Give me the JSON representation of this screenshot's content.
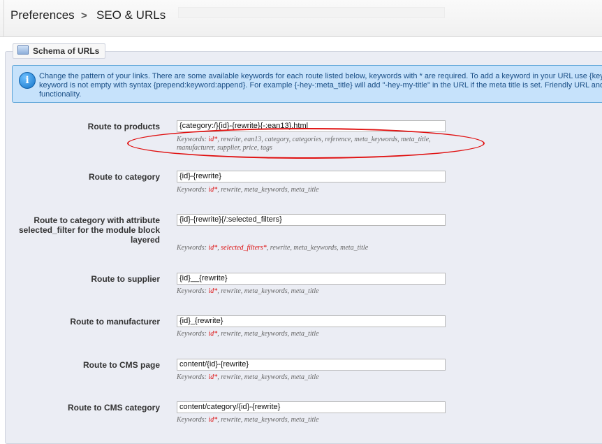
{
  "breadcrumb": {
    "parent": "Preferences",
    "separator": ">",
    "current": "SEO & URLs"
  },
  "section": {
    "legend": "Schema of URLs"
  },
  "info": {
    "text": "Change the pattern of your links. There are some available keywords for each route listed below, keywords with * are required. To add a keyword in your URL use {key keyword is not empty with syntax {prepend:keyword:append}. For example {-hey-:meta_title} will add \"-hey-my-title\" in the URL if the meta title is set. Friendly URL and functionality."
  },
  "routes": [
    {
      "label": "Route to products",
      "value": "{category:/}{id}-{rewrite}{-:ean13}.html",
      "keywords_prefix": "Keywords: ",
      "required": "id*",
      "required2": "",
      "rest": ", rewrite, ean13, category, categories, reference, meta_keywords, meta_title, manufacturer, supplier, price, tags"
    },
    {
      "label": "Route to category",
      "value": "{id}-{rewrite}",
      "keywords_prefix": "Keywords: ",
      "required": "id*",
      "required2": "",
      "rest": ", rewrite, meta_keywords, meta_title"
    },
    {
      "label": "Route to category with attribute selected_filter for the module block layered",
      "value": "{id}-{rewrite}{/:selected_filters}",
      "keywords_prefix": "Keywords: ",
      "required": "id*",
      "required2": "selected_filters*",
      "rest": ", rewrite, meta_keywords, meta_title"
    },
    {
      "label": "Route to supplier",
      "value": "{id}__{rewrite}",
      "keywords_prefix": "Keywords: ",
      "required": "id*",
      "required2": "",
      "rest": ", rewrite, meta_keywords, meta_title"
    },
    {
      "label": "Route to manufacturer",
      "value": "{id}_{rewrite}",
      "keywords_prefix": "Keywords: ",
      "required": "id*",
      "required2": "",
      "rest": ", rewrite, meta_keywords, meta_title"
    },
    {
      "label": "Route to CMS page",
      "value": "content/{id}-{rewrite}",
      "keywords_prefix": "Keywords: ",
      "required": "id*",
      "required2": "",
      "rest": ", rewrite, meta_keywords, meta_title"
    },
    {
      "label": "Route to CMS category",
      "value": "content/category/{id}-{rewrite}",
      "keywords_prefix": "Keywords: ",
      "required": "id*",
      "required2": "",
      "rest": ", rewrite, meta_keywords, meta_title"
    }
  ],
  "colors": {
    "required": "#d11111",
    "annotation": "#e01010",
    "info_bg": "#c6e2fb"
  },
  "icons": {
    "info": "info-icon",
    "legend": "schema-icon"
  }
}
